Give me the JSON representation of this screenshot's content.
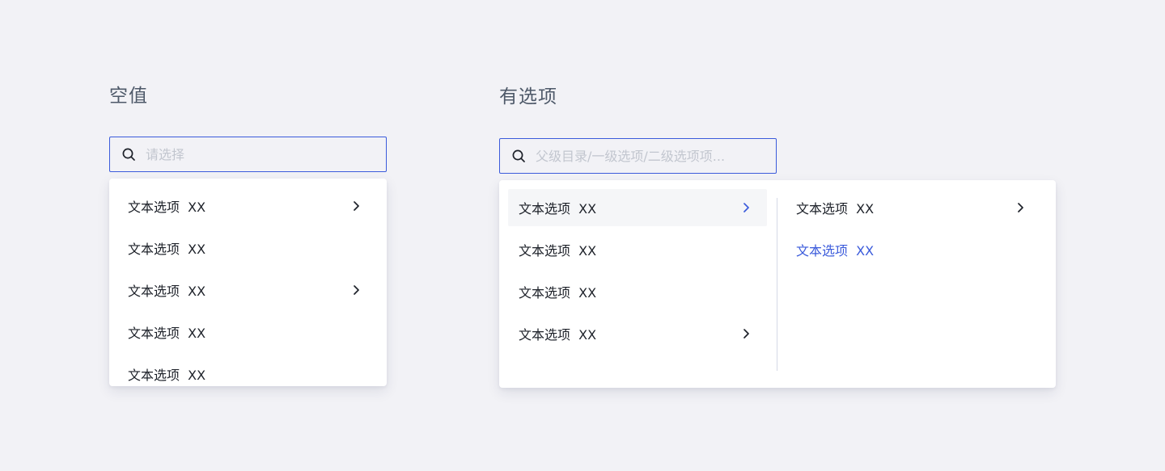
{
  "empty_section": {
    "title": "空值",
    "search": {
      "placeholder": "请选择",
      "value": ""
    },
    "options": [
      {
        "label": "文本选项  XX",
        "has_children": true
      },
      {
        "label": "文本选项  XX",
        "has_children": false
      },
      {
        "label": "文本选项  XX",
        "has_children": true
      },
      {
        "label": "文本选项  XX",
        "has_children": false
      },
      {
        "label": "文本选项  XX",
        "has_children": false
      }
    ]
  },
  "filled_section": {
    "title": "有选项",
    "search": {
      "placeholder": "父级目录/一级选项/二级选项项...",
      "value": ""
    },
    "level1_options": [
      {
        "label": "文本选项  XX",
        "has_children": true,
        "state": "hovered"
      },
      {
        "label": "文本选项  XX",
        "has_children": false,
        "state": "normal"
      },
      {
        "label": "文本选项  XX",
        "has_children": false,
        "state": "normal"
      },
      {
        "label": "文本选项  XX",
        "has_children": true,
        "state": "normal"
      }
    ],
    "level2_options": [
      {
        "label": "文本选项  XX",
        "has_children": true,
        "state": "normal"
      },
      {
        "label": "文本选项  XX",
        "has_children": false,
        "state": "selected"
      }
    ]
  },
  "colors": {
    "background": "#f2f2f6",
    "accent": "#3b5bdb",
    "text": "#1d2129",
    "title_text": "#4e5969",
    "placeholder": "#c2c6cf",
    "hover_bg": "#f5f6f8",
    "divider": "#d5d9e6"
  },
  "icons": {
    "search": "search-icon",
    "chevron": "chevron-right-icon"
  }
}
